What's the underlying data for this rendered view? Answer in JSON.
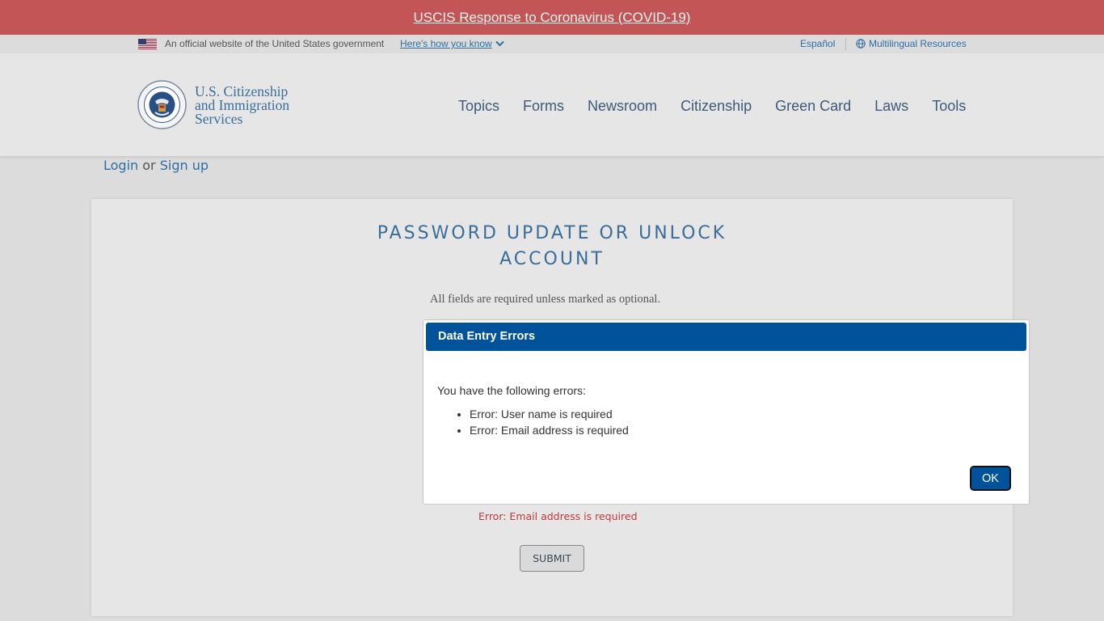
{
  "alert": {
    "link_text": "USCIS Response to Coronavirus (COVID-19)"
  },
  "gov_banner": {
    "official_text": "An official website of the United States government",
    "how_you_know": "Here's how you know",
    "espanol": "Español",
    "multilingual": "Multilingual Resources"
  },
  "header": {
    "agency_line1": "U.S. Citizenship",
    "agency_line2": "and Immigration",
    "agency_line3": "Services",
    "nav": [
      "Topics",
      "Forms",
      "Newsroom",
      "Citizenship",
      "Green Card",
      "Laws",
      "Tools"
    ]
  },
  "auth": {
    "login": "Login",
    "or": "or",
    "signup": "Sign up"
  },
  "form": {
    "title_line1": "PASSWORD UPDATE OR UNLOCK",
    "title_line2": "ACCOUNT",
    "required_note": "All fields are required unless marked as optional.",
    "email_error": "Error: Email address is required",
    "submit_label": "SUBMIT"
  },
  "modal": {
    "title": "Data Entry Errors",
    "intro": "You have the following errors:",
    "errors": [
      "Error: User name is required",
      "Error: Email address is required"
    ],
    "ok_label": "OK"
  },
  "colors": {
    "alert_bg": "#c45557",
    "link_blue": "#2f6ea3",
    "modal_blue": "#00539b",
    "error_red": "#c0393b"
  }
}
